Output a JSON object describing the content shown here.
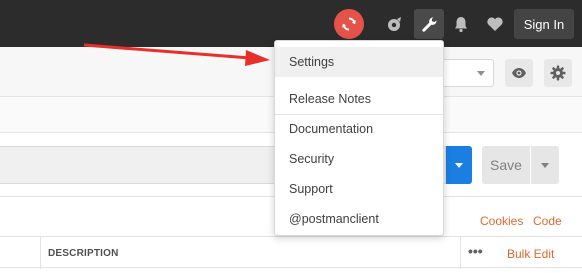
{
  "header": {
    "signin_label": "Sign In",
    "icons": [
      "sync-icon",
      "satellite-icon",
      "wrench-icon",
      "bell-icon",
      "heart-icon"
    ],
    "sync_color": "#e5524a"
  },
  "request": {
    "save_label": "Save",
    "cookies_label": "Cookies",
    "code_label": "Code"
  },
  "params_table": {
    "columns": [
      "DESCRIPTION"
    ],
    "more_label": "•••",
    "bulk_edit_label": "Bulk Edit"
  },
  "settings_menu": {
    "items": [
      {
        "label": "Settings"
      },
      {
        "label": "Release Notes"
      },
      {
        "label": "Documentation"
      },
      {
        "label": "Security"
      },
      {
        "label": "Support"
      },
      {
        "label": "@postmanclient"
      }
    ]
  },
  "annotation": {
    "color": "#e8302a"
  },
  "colors": {
    "accent_orange": "#e06a2c",
    "send_blue": "#1a7fe0",
    "topbar": "#2c2c2c"
  }
}
